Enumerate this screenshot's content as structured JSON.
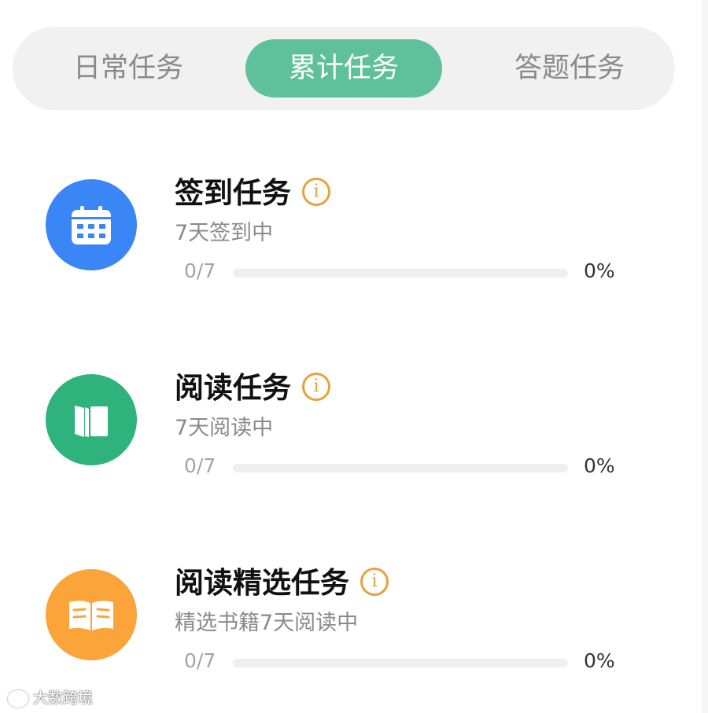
{
  "tabs": [
    {
      "label": "日常任务",
      "active": false
    },
    {
      "label": "累计任务",
      "active": true
    },
    {
      "label": "答题任务",
      "active": false
    }
  ],
  "colors": {
    "accent": "#5ec19b",
    "info": "#e6a23c",
    "icon_blue": "#3b86f7",
    "icon_green": "#2fb37c",
    "icon_orange": "#fba43a"
  },
  "tasks": [
    {
      "icon": "calendar-icon",
      "title": "签到任务",
      "info_symbol": "i",
      "subtitle": "7天签到中",
      "progress_count": "0/7",
      "progress_percent_text": "0%",
      "progress_fraction": 0
    },
    {
      "icon": "book-icon",
      "title": "阅读任务",
      "info_symbol": "i",
      "subtitle": "7天阅读中",
      "progress_count": "0/7",
      "progress_percent_text": "0%",
      "progress_fraction": 0
    },
    {
      "icon": "open-book-icon",
      "title": "阅读精选任务",
      "info_symbol": "i",
      "subtitle": "精选书籍7天阅读中",
      "progress_count": "0/7",
      "progress_percent_text": "0%",
      "progress_fraction": 0
    }
  ],
  "watermark": {
    "text": "大数跨境"
  }
}
